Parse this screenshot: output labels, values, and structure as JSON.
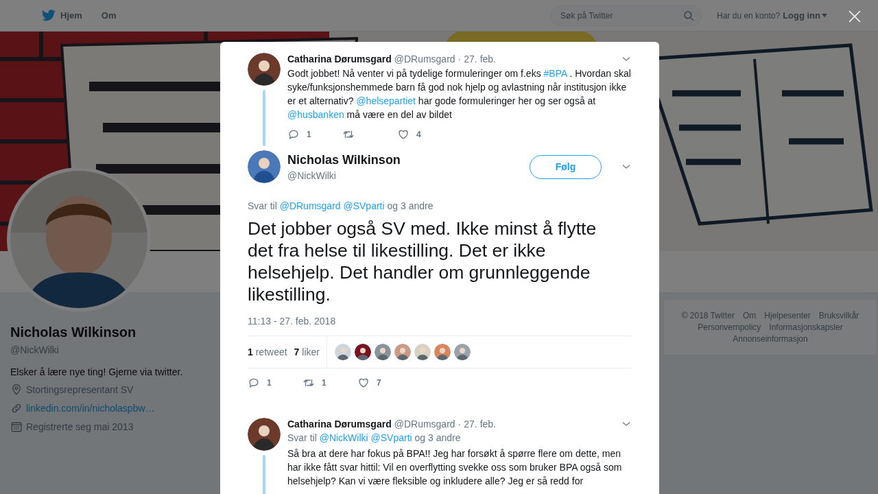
{
  "top_nav": {
    "items": [
      {
        "label": "Hjem",
        "kind": "home"
      },
      {
        "label": "Om",
        "kind": "plain"
      }
    ],
    "search": {
      "placeholder": "Søk på Twitter"
    },
    "account_prompt": "Har du en konto?",
    "login": "Logg inn"
  },
  "profile": {
    "name": "Nicholas Wilkinson",
    "handle": "@NickWilki",
    "bio": "Elsker å lære nye ting! Gjerne via twitter.",
    "details": [
      {
        "kind": "location",
        "text": "Stortingsrepresentant SV"
      },
      {
        "kind": "link",
        "text": "linkedin.com/in/nicholaspbw…"
      },
      {
        "kind": "joined",
        "text": "Registrerte seg mai 2013"
      }
    ]
  },
  "footer": {
    "links": [
      "© 2018 Twitter",
      "Om",
      "Hjelpesenter",
      "Bruksvilkår",
      "Personvernpolicy",
      "Informasjonskapsler",
      "Annonseinformasjon"
    ]
  },
  "modal": {
    "parent_tweet": {
      "author": "Catharina Dørumsgard",
      "handle": "@DRumsgard",
      "separator": "·",
      "date": "27. feb.",
      "text": [
        {
          "kind": "plain",
          "text": "Godt jobbet! Nå venter vi på tydelige formuleringer om f.eks "
        },
        {
          "kind": "link",
          "text": "#BPA"
        },
        {
          "kind": "plain",
          "text": " . Hvordan skal syke/funksjonshemmede barn få god nok hjelp og avlastning når institusjon ikke er et alternativ? "
        },
        {
          "kind": "link",
          "text": "@helsepartiet"
        },
        {
          "kind": "plain",
          "text": " har gode formuleringer her og ser også at "
        },
        {
          "kind": "link",
          "text": "@husbanken"
        },
        {
          "kind": "plain",
          "text": " må være en del av bildet"
        }
      ],
      "actions": [
        {
          "kind": "reply",
          "count": "1"
        },
        {
          "kind": "retweet"
        },
        {
          "kind": "like",
          "count": "4"
        }
      ]
    },
    "main_tweet": {
      "author": "Nicholas Wilkinson",
      "handle": "@NickWilki",
      "follow": "Følg",
      "reply_to": {
        "prefix": "Svar til",
        "mentions": [
          "@DRumsgard",
          "@SVparti"
        ],
        "suffix": "og 3 andre"
      },
      "text": "Det jobber også SV med. Ikke minst å flytte det fra helse til likestilling. Det er ikke helsehjelp. Det handler om grunnleggende likestilling.",
      "timestamp": "11:13 - 27. feb. 2018",
      "stats": [
        {
          "count": "1",
          "label": "retweet"
        },
        {
          "count": "7",
          "label": "liker"
        }
      ],
      "actions": [
        {
          "kind": "reply",
          "count": "1"
        },
        {
          "kind": "retweet",
          "count": "1"
        },
        {
          "kind": "like",
          "count": "7"
        }
      ]
    },
    "reply_tweet": {
      "author": "Catharina Dørumsgard",
      "handle": "@DRumsgard",
      "separator": "·",
      "date": "27. feb.",
      "reply_to": {
        "prefix": "Svar til",
        "mentions": [
          "@NickWilki",
          "@SVparti"
        ],
        "suffix": "og 3 andre"
      },
      "text": [
        {
          "kind": "plain",
          "text": "Så bra at dere har fokus på BPA!! Jeg har forsøkt å spørre flere om dette, men har ikke fått svar hittil: Vil en overflytting svekke oss som bruker BPA også som helsehjelp? Kan vi være fleksible og inkludere alle? Jeg er så redd for"
        }
      ]
    }
  }
}
